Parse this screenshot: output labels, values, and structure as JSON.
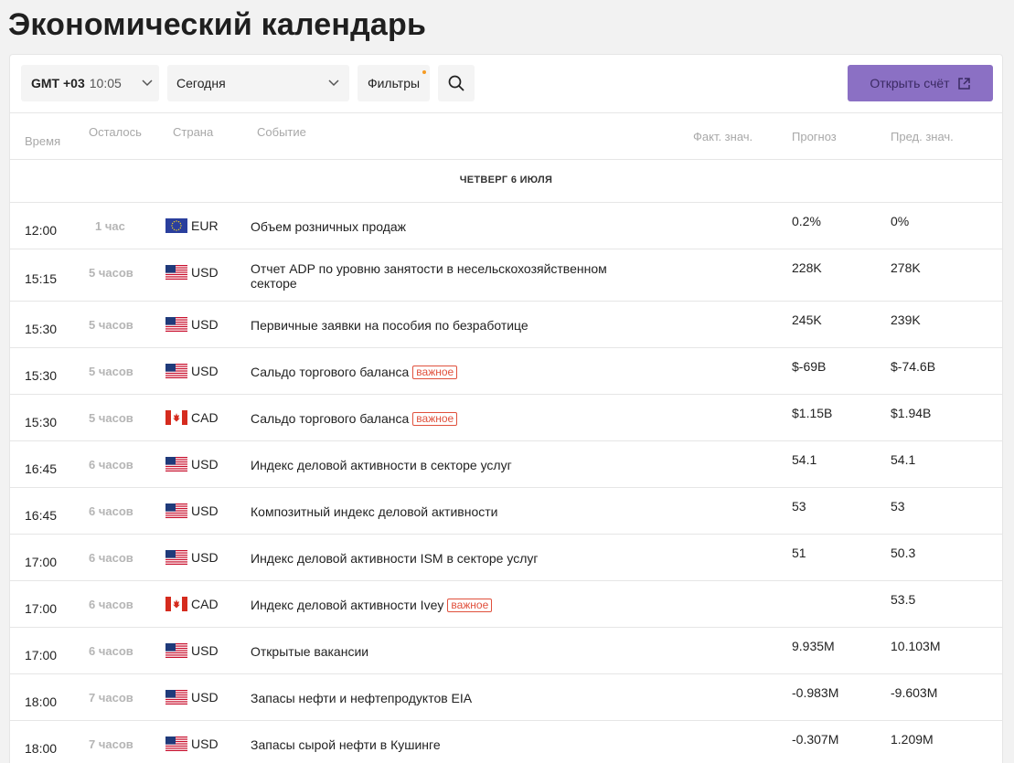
{
  "page": {
    "title": "Экономический календарь"
  },
  "toolbar": {
    "timezone": "GMT +03",
    "time": "10:05",
    "day": "Сегодня",
    "filters_label": "Фильтры",
    "open_account_label": "Открыть счёт"
  },
  "columns": {
    "time": "Время",
    "left": "Осталось",
    "country": "Страна",
    "event": "Событие",
    "actual": "Факт. знач.",
    "forecast": "Прогноз",
    "previous": "Пред. знач."
  },
  "day_header": "ЧЕТВЕРГ 6 ИЮЛЯ",
  "important_label": "важное",
  "rows": [
    {
      "time": "12:00",
      "left": "1 час",
      "flag": "eu-flag",
      "currency": "EUR",
      "event": "Объем розничных продаж",
      "important": false,
      "forecast": "0.2%",
      "previous": "0%"
    },
    {
      "time": "15:15",
      "left": "5 часов",
      "flag": "us-flag",
      "currency": "USD",
      "event": "Отчет ADP по уровню занятости в несельскохозяйственном секторе",
      "important": false,
      "forecast": "228K",
      "previous": "278K"
    },
    {
      "time": "15:30",
      "left": "5 часов",
      "flag": "us-flag",
      "currency": "USD",
      "event": "Первичные заявки на пособия по безработице",
      "important": false,
      "forecast": "245K",
      "previous": "239K"
    },
    {
      "time": "15:30",
      "left": "5 часов",
      "flag": "us-flag",
      "currency": "USD",
      "event": "Сальдо торгового баланса",
      "important": true,
      "forecast": "$-69B",
      "previous": "$-74.6B"
    },
    {
      "time": "15:30",
      "left": "5 часов",
      "flag": "ca-flag",
      "currency": "CAD",
      "event": "Сальдо торгового баланса",
      "important": true,
      "forecast": "$1.15B",
      "previous": "$1.94B"
    },
    {
      "time": "16:45",
      "left": "6 часов",
      "flag": "us-flag",
      "currency": "USD",
      "event": "Индекс деловой активности в секторе услуг",
      "important": false,
      "forecast": "54.1",
      "previous": "54.1"
    },
    {
      "time": "16:45",
      "left": "6 часов",
      "flag": "us-flag",
      "currency": "USD",
      "event": "Композитный индекс деловой активности",
      "important": false,
      "forecast": "53",
      "previous": "53"
    },
    {
      "time": "17:00",
      "left": "6 часов",
      "flag": "us-flag",
      "currency": "USD",
      "event": "Индекс деловой активности ISM в секторе услуг",
      "important": false,
      "forecast": "51",
      "previous": "50.3"
    },
    {
      "time": "17:00",
      "left": "6 часов",
      "flag": "ca-flag",
      "currency": "CAD",
      "event": "Индекс деловой активности Ivey",
      "important": true,
      "forecast": "",
      "previous": "53.5"
    },
    {
      "time": "17:00",
      "left": "6 часов",
      "flag": "us-flag",
      "currency": "USD",
      "event": "Открытые вакансии",
      "important": false,
      "forecast": "9.935M",
      "previous": "10.103M"
    },
    {
      "time": "18:00",
      "left": "7 часов",
      "flag": "us-flag",
      "currency": "USD",
      "event": "Запасы нефти и нефтепродуктов EIA",
      "important": false,
      "forecast": "-0.983M",
      "previous": "-9.603M"
    },
    {
      "time": "18:00",
      "left": "7 часов",
      "flag": "us-flag",
      "currency": "USD",
      "event": "Запасы сырой нефти в Кушинге",
      "important": false,
      "forecast": "-0.307M",
      "previous": "1.209M"
    }
  ]
}
